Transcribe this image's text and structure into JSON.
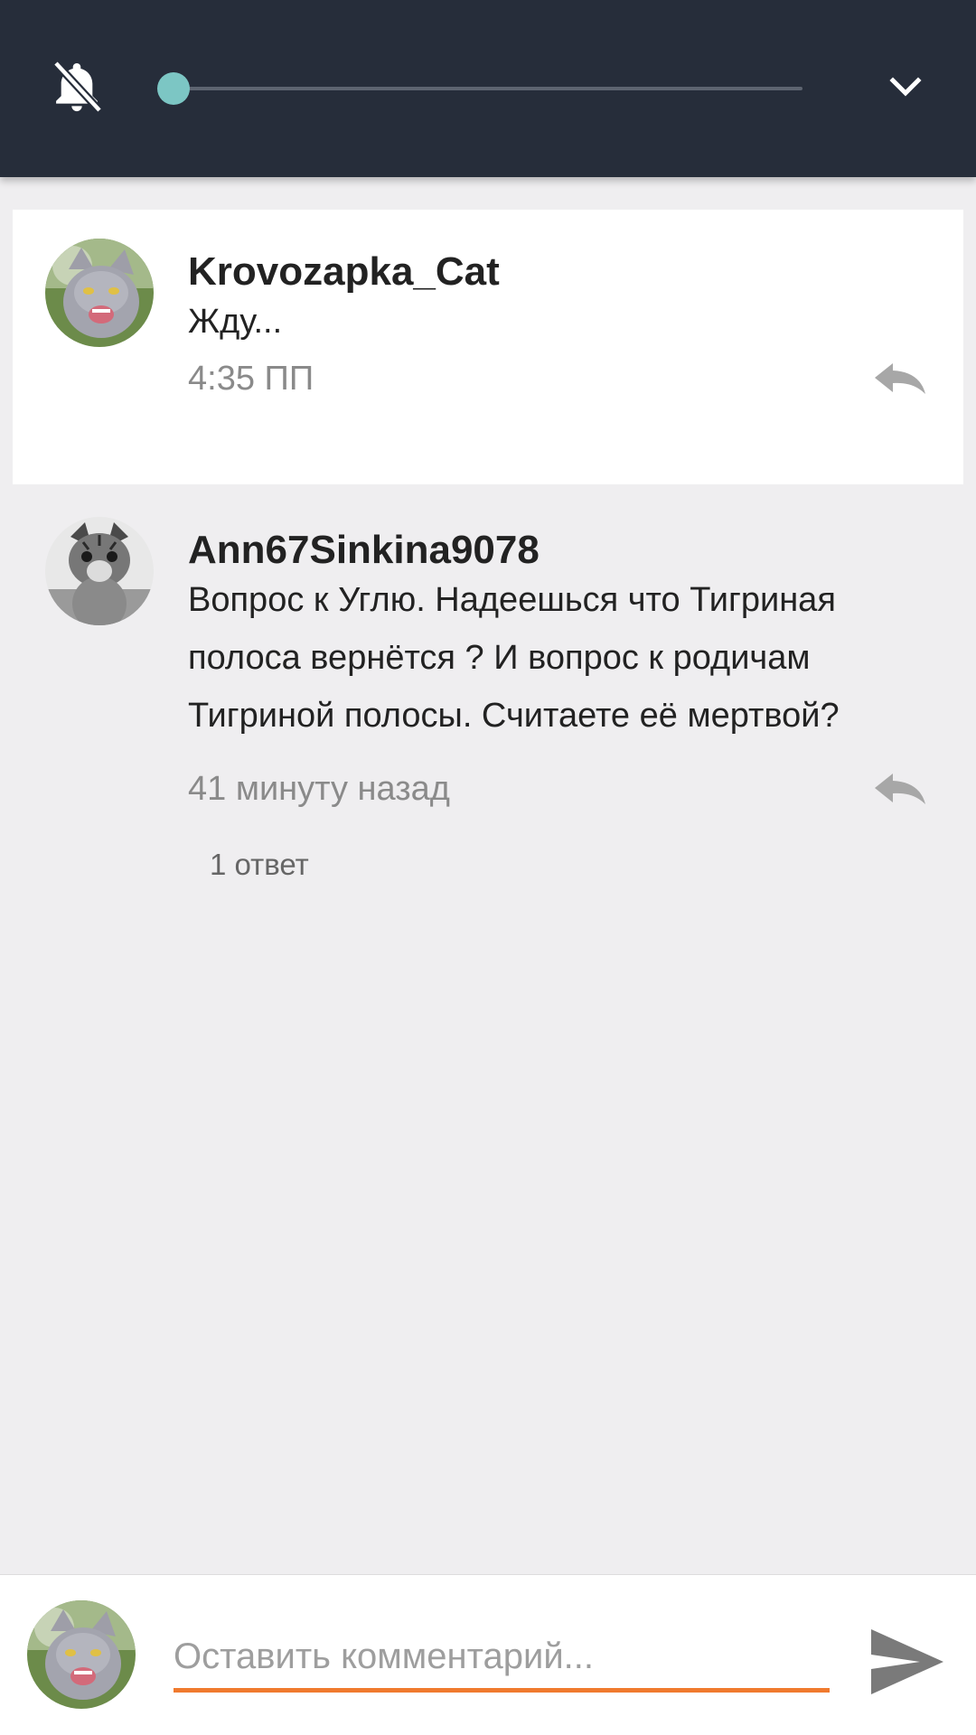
{
  "volume_panel": {
    "level": 0,
    "icons": {
      "mute": "bell-off-icon",
      "collapse": "chevron-down-icon"
    },
    "accent_color": "#7cc6c4",
    "background_color": "#262d3a"
  },
  "comments": [
    {
      "author": "Krovozapka_Cat",
      "text": "Жду...",
      "time": "4:35 ПП",
      "avatar": "gray-cat-hissing-avatar",
      "reply_icon": "reply-icon",
      "highlighted": true
    },
    {
      "author": "Ann67Sinkina9078",
      "text": "Вопрос к Углю. Надеешься что Тигриная полоса вернётся ? И вопрос к родичам Тигриной полосы. Считаете её мертвой?",
      "time": "41 минуту назад",
      "replies": "1 ответ",
      "avatar": "grayscale-kitten-avatar",
      "reply_icon": "reply-icon",
      "highlighted": false
    }
  ],
  "compose": {
    "placeholder": "Оставить комментарий...",
    "value": "",
    "avatar": "gray-cat-hissing-avatar",
    "send_icon": "send-icon",
    "accent_color": "#f07a2e"
  }
}
